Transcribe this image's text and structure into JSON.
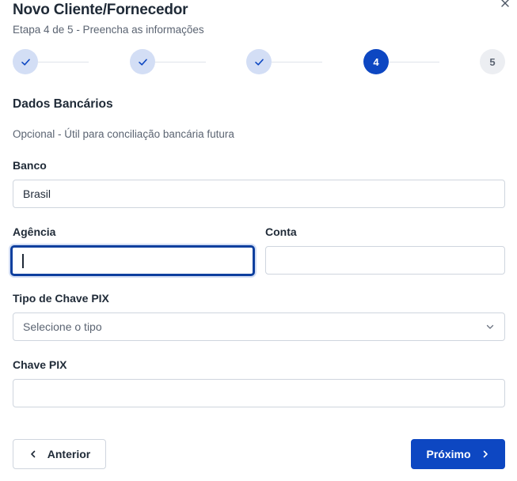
{
  "dialog": {
    "title": "Novo Cliente/Fornecedor",
    "subtitle": "Etapa 4 de 5 - Preencha as informações",
    "close_icon": "close-icon"
  },
  "stepper": {
    "steps": [
      {
        "state": "done",
        "label": "",
        "icon": "check-icon"
      },
      {
        "state": "done",
        "label": "",
        "icon": "check-icon"
      },
      {
        "state": "done",
        "label": "",
        "icon": "check-icon"
      },
      {
        "state": "active",
        "label": "4"
      },
      {
        "state": "todo",
        "label": "5"
      }
    ]
  },
  "section": {
    "title": "Dados Bancários",
    "description": "Opcional - Útil para conciliação bancária futura"
  },
  "form": {
    "banco": {
      "label": "Banco",
      "value": "Brasil"
    },
    "agencia": {
      "label": "Agência",
      "value": ""
    },
    "conta": {
      "label": "Conta",
      "value": ""
    },
    "tipo_pix": {
      "label": "Tipo de Chave PIX",
      "placeholder": "Selecione o tipo"
    },
    "chave_pix": {
      "label": "Chave PIX",
      "value": ""
    }
  },
  "footer": {
    "prev_label": "Anterior",
    "next_label": "Próximo"
  },
  "colors": {
    "primary": "#0d47c2",
    "step_done_bg": "#d3def5",
    "step_todo_bg": "#eceef2",
    "border": "#cfd5de"
  }
}
